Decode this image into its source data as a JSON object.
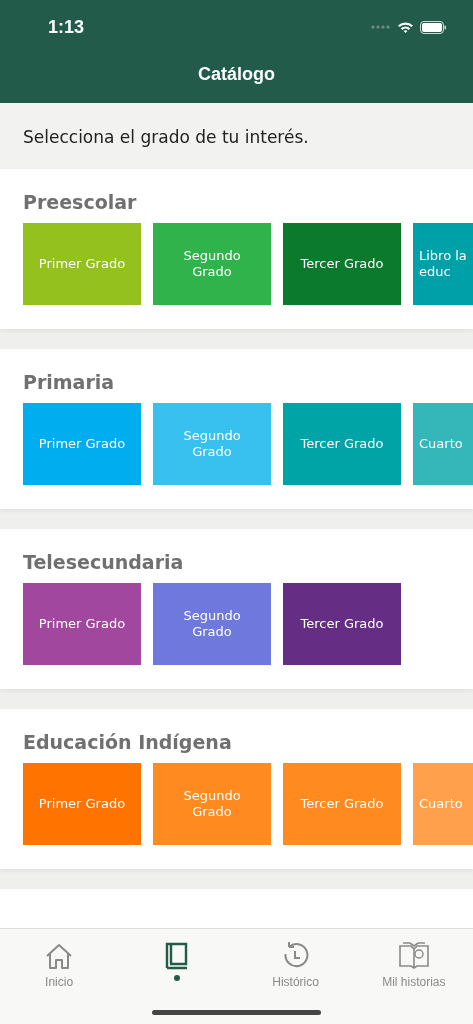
{
  "status_bar": {
    "time": "1:13"
  },
  "header": {
    "title": "Catálogo"
  },
  "prompt": "Selecciona el grado de tu interés.",
  "sections": [
    {
      "title": "Preescolar",
      "tiles": [
        {
          "label": "Primer Grado",
          "color": "#95c11f",
          "partial": false
        },
        {
          "label": "Segundo Grado",
          "color": "#2fb34a",
          "partial": false
        },
        {
          "label": "Tercer Grado",
          "color": "#0b7a2d",
          "partial": false
        },
        {
          "label": "Libro la educ",
          "color": "#00a0a8",
          "partial": true
        }
      ]
    },
    {
      "title": "Primaria",
      "tiles": [
        {
          "label": "Primer Grado",
          "color": "#00aeef",
          "partial": false
        },
        {
          "label": "Segundo Grado",
          "color": "#38c0ef",
          "partial": false
        },
        {
          "label": "Tercer Grado",
          "color": "#00a3a6",
          "partial": false
        },
        {
          "label": "Cuarto",
          "color": "#35b6b8",
          "partial": true
        }
      ]
    },
    {
      "title": "Telesecundaria",
      "tiles": [
        {
          "label": "Primer Grado",
          "color": "#a1479d",
          "partial": false
        },
        {
          "label": "Segundo Grado",
          "color": "#6f78dc",
          "partial": false
        },
        {
          "label": "Tercer Grado",
          "color": "#662d85",
          "partial": false
        }
      ]
    },
    {
      "title": "Educación Indígena",
      "tiles": [
        {
          "label": "Primer Grado",
          "color": "#ff7300",
          "partial": false
        },
        {
          "label": "Segundo Grado",
          "color": "#ff8a1f",
          "partial": false
        },
        {
          "label": "Tercer Grado",
          "color": "#ff8a1f",
          "partial": false
        },
        {
          "label": "Cuarto",
          "color": "#ffa04d",
          "partial": true
        }
      ]
    }
  ],
  "tab_bar": [
    {
      "kind": "home",
      "label": "Inicio",
      "selected": false
    },
    {
      "kind": "book",
      "selected": true
    },
    {
      "kind": "history",
      "label": "Histórico",
      "selected": false
    },
    {
      "kind": "stories",
      "label": "Mil historias",
      "selected": false
    }
  ]
}
